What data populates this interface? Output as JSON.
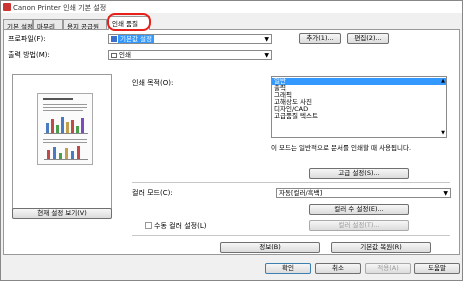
{
  "window": {
    "title": "Canon Printer 인쇄 기본 설정"
  },
  "tabs": [
    {
      "label": "기본 설정"
    },
    {
      "label": "마무리"
    },
    {
      "label": "용지 공급원"
    },
    {
      "label": "인쇄 품질"
    }
  ],
  "profile": {
    "label": "프로파일(F):",
    "value": "기본값 설정",
    "add_button": "추가(1)...",
    "edit_button": "편집(2)..."
  },
  "output": {
    "label": "출력 방법(M):",
    "value": "인쇄"
  },
  "purpose": {
    "label": "인쇄 목적(O):",
    "items": [
      "일반",
      "출력",
      "그래픽",
      "고해상도 사진",
      "디자인/CAD",
      "고급품질 텍스트"
    ],
    "selected_index": 0,
    "description": "이 모드는 일반적으로 문서를 인쇄할 때 사용됩니다.",
    "advanced_button": "고급 설정(S)..."
  },
  "color_mode": {
    "label": "컬러 모드(C):",
    "value": "자동[컬러/흑백]",
    "color_settings_button": "컬러 수 설정(E)...",
    "manual_color_label": "수동 컬러 설정(L)",
    "manual_color_checked": false,
    "color_setting_button": "컬러 설정(T)..."
  },
  "preview": {
    "view_settings_button": "현재 설정 보기(V)"
  },
  "panel_buttons": {
    "info": "정보(B)",
    "restore_defaults": "기본값 복원(R)"
  },
  "dialog_buttons": {
    "ok": "확인",
    "cancel": "취소",
    "apply": "적용(A)",
    "help": "도움말"
  }
}
